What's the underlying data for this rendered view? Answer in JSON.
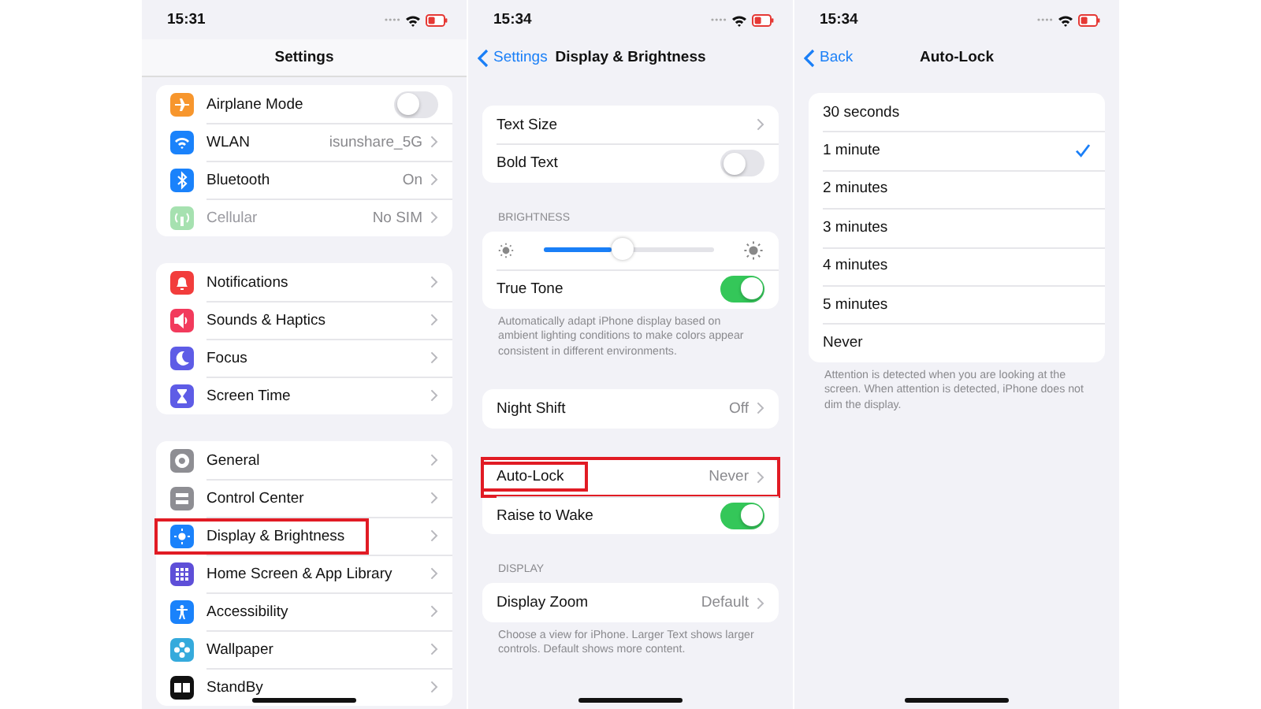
{
  "screens": [
    {
      "time": "15:31",
      "nav": {
        "title": "Settings"
      },
      "sections": [
        {
          "rows": [
            {
              "kind": "toggle",
              "label": "Airplane Mode",
              "on": false,
              "color": "#f7962d",
              "disabled": false,
              "highlighted": false
            },
            {
              "kind": "link",
              "label": "WLAN",
              "value": "isunshare_5G",
              "color": "#1a82fb",
              "disabled": false,
              "highlighted": false
            },
            {
              "kind": "link",
              "label": "Bluetooth",
              "value": "On",
              "color": "#1a82fb",
              "disabled": false,
              "highlighted": false
            },
            {
              "kind": "link",
              "label": "Cellular",
              "value": "No SIM",
              "color": "#a6e1b0",
              "disabled": true,
              "highlighted": false
            }
          ]
        },
        {
          "rows": [
            {
              "kind": "link",
              "label": "Notifications",
              "color": "#f23d3c",
              "disabled": false,
              "highlighted": false
            },
            {
              "kind": "link",
              "label": "Sounds & Haptics",
              "color": "#f23a5c",
              "disabled": false,
              "highlighted": false
            },
            {
              "kind": "link",
              "label": "Focus",
              "color": "#5e5ce6",
              "disabled": false,
              "highlighted": false
            },
            {
              "kind": "link",
              "label": "Screen Time",
              "color": "#5e5ce6",
              "disabled": false,
              "highlighted": false
            }
          ]
        },
        {
          "rows": [
            {
              "kind": "link",
              "label": "General",
              "color": "#8e8e93",
              "disabled": false,
              "highlighted": false
            },
            {
              "kind": "link",
              "label": "Control Center",
              "color": "#8e8e93",
              "disabled": false,
              "highlighted": false
            },
            {
              "kind": "link",
              "label": "Display & Brightness",
              "color": "#1a82fb",
              "disabled": false,
              "highlighted": true
            },
            {
              "kind": "link",
              "label": "Home Screen & App Library",
              "color": "#5e4fd8",
              "disabled": false,
              "highlighted": false
            },
            {
              "kind": "link",
              "label": "Accessibility",
              "color": "#1a82fb",
              "disabled": false,
              "highlighted": false
            },
            {
              "kind": "link",
              "label": "Wallpaper",
              "color": "#35aadc",
              "disabled": false,
              "highlighted": false
            },
            {
              "kind": "link",
              "label": "StandBy",
              "color": "#111111",
              "disabled": false,
              "highlighted": false
            }
          ]
        }
      ]
    },
    {
      "time": "15:34",
      "nav": {
        "back": "Settings",
        "title": "Display & Brightness"
      },
      "sections": [
        {
          "rows": [
            {
              "kind": "link",
              "label": "Text Size",
              "disabled": false,
              "highlighted": false
            },
            {
              "kind": "toggle",
              "label": "Bold Text",
              "on": false,
              "disabled": false,
              "highlighted": false
            }
          ]
        },
        {
          "header": "BRIGHTNESS",
          "footer": "Automatically adapt iPhone display based on ambient lighting conditions to make colors appear consistent in different environments.",
          "rows": [
            {
              "kind": "slider",
              "level": 0.4
            },
            {
              "kind": "toggle",
              "label": "True Tone",
              "on": true,
              "disabled": false,
              "highlighted": false
            }
          ]
        },
        {
          "rows": [
            {
              "kind": "link",
              "label": "Night Shift",
              "value": "Off",
              "disabled": false,
              "highlighted": false
            }
          ]
        },
        {
          "rows": [
            {
              "kind": "link",
              "label": "Auto-Lock",
              "value": "Never",
              "disabled": false,
              "highlighted": true
            },
            {
              "kind": "toggle",
              "label": "Raise to Wake",
              "on": true,
              "disabled": false,
              "highlighted": false
            }
          ]
        },
        {
          "header": "DISPLAY",
          "footer": "Choose a view for iPhone. Larger Text shows larger controls. Default shows more content.",
          "rows": [
            {
              "kind": "link",
              "label": "Display Zoom",
              "value": "Default",
              "disabled": false,
              "highlighted": false
            }
          ]
        }
      ]
    },
    {
      "time": "15:34",
      "nav": {
        "back": "Back",
        "title": "Auto-Lock"
      },
      "sections": [
        {
          "footer": "Attention is detected when you are looking at the screen. When attention is detected, iPhone does not dim the display.",
          "rows": [
            {
              "kind": "check",
              "label": "30 seconds",
              "selected": false,
              "disabled": false,
              "highlighted": false
            },
            {
              "kind": "check",
              "label": "1 minute",
              "selected": true,
              "disabled": false,
              "highlighted": false
            },
            {
              "kind": "check",
              "label": "2 minutes",
              "selected": false,
              "disabled": false,
              "highlighted": false
            },
            {
              "kind": "check",
              "label": "3 minutes",
              "selected": false,
              "disabled": false,
              "highlighted": false
            },
            {
              "kind": "check",
              "label": "4 minutes",
              "selected": false,
              "disabled": false,
              "highlighted": false
            },
            {
              "kind": "check",
              "label": "5 minutes",
              "selected": false,
              "disabled": false,
              "highlighted": false
            },
            {
              "kind": "check",
              "label": "Never",
              "selected": false,
              "disabled": false,
              "highlighted": false
            }
          ]
        }
      ]
    }
  ]
}
